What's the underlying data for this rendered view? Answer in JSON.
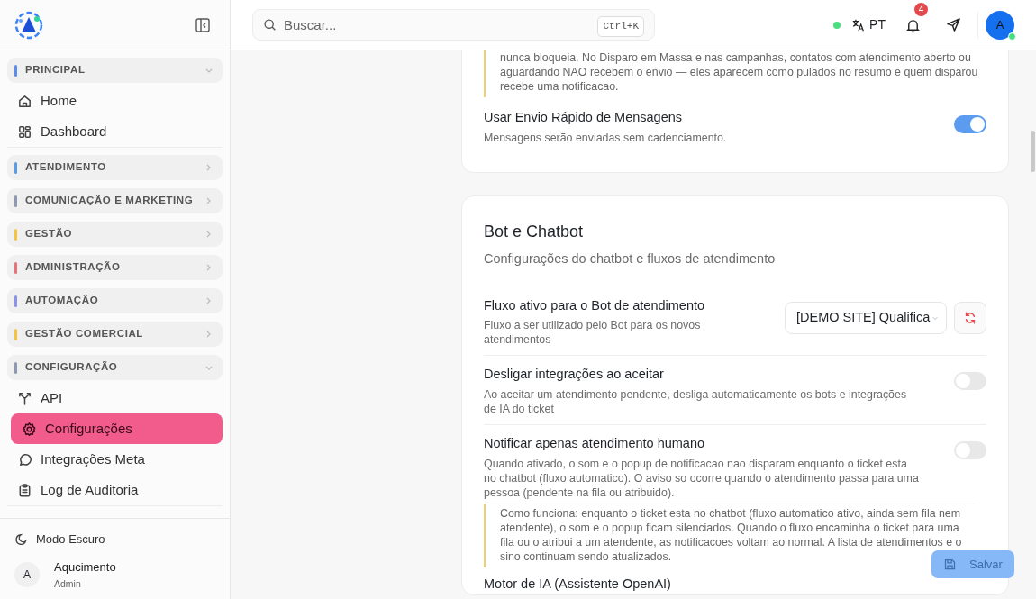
{
  "sidebar": {
    "groups": [
      {
        "label": "PRINCIPAL",
        "color": "#5b8def",
        "expanded": true,
        "items": [
          {
            "label": "Home",
            "selected": false
          },
          {
            "label": "Dashboard",
            "selected": false
          }
        ]
      },
      {
        "label": "ATENDIMENTO",
        "color": "#5b9be8",
        "expanded": false
      },
      {
        "label": "COMUNICAÇÃO E MARKETING",
        "color": "#8d99ae",
        "expanded": false
      },
      {
        "label": "GESTÃO",
        "color": "#f5c542",
        "expanded": false
      },
      {
        "label": "ADMINISTRAÇÃO",
        "color": "#e8717a",
        "expanded": false
      },
      {
        "label": "AUTOMAÇÃO",
        "color": "#8b93e8",
        "expanded": false
      },
      {
        "label": "GESTÃO COMERCIAL",
        "color": "#f5c542",
        "expanded": false
      },
      {
        "label": "CONFIGURAÇÃO",
        "color": "#8d99ae",
        "expanded": true,
        "items": [
          {
            "label": "API",
            "selected": false
          },
          {
            "label": "Configurações",
            "selected": true
          },
          {
            "label": "Integrações Meta",
            "selected": false
          },
          {
            "label": "Log de Auditoria",
            "selected": false
          }
        ]
      }
    ],
    "dark_mode": "Modo Escuro",
    "user": {
      "initial": "A",
      "name": "Aqucimento",
      "role": "Admin"
    }
  },
  "header": {
    "search": {
      "placeholder": "Buscar...",
      "shortcut": "Ctrl+K"
    },
    "online": true,
    "language": "PT",
    "notifications": "4",
    "avatar": {
      "initial": "A",
      "online": true
    }
  },
  "sections": [
    {
      "note": "nunca bloqueia. No Disparo em Massa e nas campanhas, contatos com atendimento aberto ou aguardando NAO recebem o envio — eles aparecem como pulados no resumo e quem disparou recebe uma notificacao.",
      "settings": [
        {
          "kind": "toggle",
          "title": "Usar Envio Rápido de Mensagens",
          "description": "Mensagens serão enviadas sem cadenciamento.",
          "on": true
        }
      ]
    },
    {
      "title": "Bot e Chatbot",
      "subtitle": "Configurações do chatbot e fluxos de atendimento",
      "settings": [
        {
          "kind": "select",
          "title": "Fluxo ativo para o Bot de atendimento",
          "description": "Fluxo a ser utilizado pelo Bot para os novos atendimentos",
          "value": "[DEMO SITE] Qualifica"
        },
        {
          "kind": "toggle",
          "title": "Desligar integrações ao aceitar",
          "description": "Ao aceitar um atendimento pendente, desliga automaticamente os bots e integrações de IA do ticket",
          "on": false
        },
        {
          "kind": "toggle",
          "title": "Notificar apenas atendimento humano",
          "description": "Quando ativado, o som e o popup de notificacao nao disparam enquanto o ticket esta no chatbot (fluxo automatico). O aviso so ocorre quando o atendimento passa para uma pessoa (pendente na fila ou atribuido).",
          "on": false,
          "note": "Como funciona: enquanto o ticket esta no chatbot (fluxo automatico ativo, ainda sem fila nem atendente), o som e o popup ficam silenciados. Quando o fluxo encaminha o ticket para uma fila ou o atribui a um atendente, as notificacoes voltam ao normal. A lista de atendimentos e o sino continuam sendo atualizados."
        },
        {
          "kind": "heading",
          "title": "Motor de IA (Assistente OpenAI)"
        }
      ]
    }
  ],
  "save_button": {
    "label": "Salvar",
    "disabled": true
  }
}
